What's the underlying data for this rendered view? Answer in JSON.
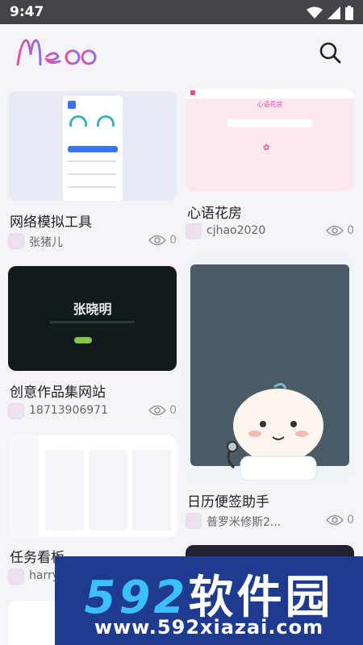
{
  "status_bar": {
    "time": "9:47"
  },
  "app": {
    "logo_text": "Meoo"
  },
  "colors": {
    "accent_pink": "#e64e9b",
    "accent_purple": "#8e6cf0",
    "watermark_bg": "#1f3b8f",
    "watermark_num": "#3bc0ff"
  },
  "cards": [
    {
      "title": "网络模拟工具",
      "author": "张猪儿",
      "views": "0"
    },
    {
      "title": "心语花房",
      "author": "cjhao2020",
      "views": "0",
      "thumb_text": "心语花房"
    },
    {
      "title": "创意作品集网站",
      "author": "18713906971",
      "views": "0",
      "thumb_text": "张晓明"
    },
    {
      "title": "日历便签助手",
      "author": "普罗米修斯2...",
      "views": "0"
    },
    {
      "title": "任务看板",
      "author": "harry",
      "views": ""
    }
  ],
  "watermark": {
    "line1_num": "592",
    "line1_text": "软件园",
    "line2": "www.592xiazai.com"
  }
}
